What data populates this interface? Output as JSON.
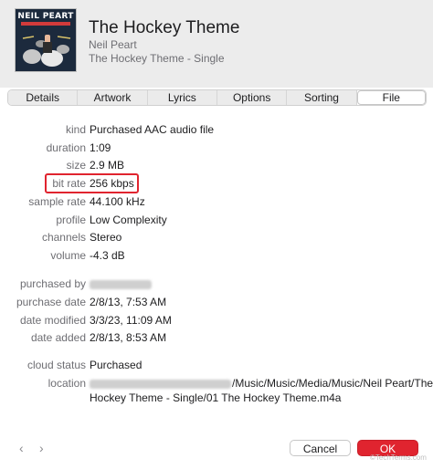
{
  "track": {
    "title": "The Hockey Theme",
    "artist": "Neil Peart",
    "album": "The Hockey Theme - Single",
    "artwork_text": "NEIL PEART"
  },
  "tabs": [
    {
      "label": "Details",
      "active": false
    },
    {
      "label": "Artwork",
      "active": false
    },
    {
      "label": "Lyrics",
      "active": false
    },
    {
      "label": "Options",
      "active": false
    },
    {
      "label": "Sorting",
      "active": false
    },
    {
      "label": "File",
      "active": true
    }
  ],
  "file": {
    "kind": {
      "label": "kind",
      "value": "Purchased AAC audio file"
    },
    "duration": {
      "label": "duration",
      "value": "1:09"
    },
    "size": {
      "label": "size",
      "value": "2.9 MB"
    },
    "bit_rate": {
      "label": "bit rate",
      "value": "256 kbps"
    },
    "sample_rate": {
      "label": "sample rate",
      "value": "44.100 kHz"
    },
    "profile": {
      "label": "profile",
      "value": "Low Complexity"
    },
    "channels": {
      "label": "channels",
      "value": "Stereo"
    },
    "volume": {
      "label": "volume",
      "value": "-4.3 dB"
    },
    "purchased_by": {
      "label": "purchased by"
    },
    "purchase_date": {
      "label": "purchase date",
      "value": "2/8/13, 7:53 AM"
    },
    "date_modified": {
      "label": "date modified",
      "value": "3/3/23, 11:09 AM"
    },
    "date_added": {
      "label": "date added",
      "value": "2/8/13, 8:53 AM"
    },
    "cloud_status": {
      "label": "cloud status",
      "value": "Purchased"
    },
    "location": {
      "label": "location",
      "value_line1": "/Music/Music/Media/Music/Neil Peart/The",
      "value_line2": "Hockey Theme - Single/01 The Hockey Theme.m4a"
    }
  },
  "footer": {
    "prev_icon": "‹",
    "next_icon": "›",
    "cancel_label": "Cancel",
    "ok_label": "OK",
    "watermark": "©TechTerms.com"
  },
  "colors": {
    "accent": "#e0242f",
    "highlight_box": "#e0242f"
  }
}
